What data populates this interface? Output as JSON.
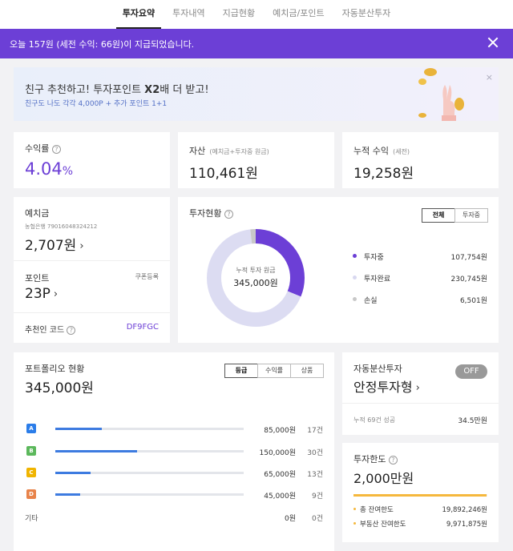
{
  "nav": {
    "tabs": [
      "투자요약",
      "투자내역",
      "지급현황",
      "예치금/포인트",
      "자동분산투자"
    ]
  },
  "notice": {
    "text": "오늘 157원 (세전 수익: 66원)이 지급되었습니다."
  },
  "promo": {
    "title_pre": "친구 추천하고! 투자포인트 ",
    "title_bold": "X2",
    "title_post": "배 더 받고!",
    "subtitle": "친구도 나도 각각 4,000P + 추가 포인트 1+1",
    "close": "×"
  },
  "return_card": {
    "label": "수익률",
    "value": "4.04",
    "unit": "%",
    "color": "#6c3fd6"
  },
  "asset_card": {
    "label": "자산",
    "sub": "(예치금+투자중 원금)",
    "value": "110,461원"
  },
  "cum_card": {
    "label": "누적 수익",
    "sub": "(세전)",
    "value": "19,258원"
  },
  "deposit_card": {
    "label": "예치금",
    "account": "농협은행 79016048324212",
    "value": "2,707원"
  },
  "point_card": {
    "label": "포인트",
    "coupon": "쿠폰등록",
    "value": "23P"
  },
  "referral": {
    "label": "추천인 코드",
    "code": "DF9FGC"
  },
  "invest_status": {
    "label": "투자현황",
    "buttons": [
      "전체",
      "투자중"
    ],
    "center_label": "누적 투자 원금",
    "center_value": "345,000원",
    "legend": [
      {
        "name": "투자중",
        "amount": "107,754원",
        "value": 107754,
        "color": "#6c3fd6"
      },
      {
        "name": "투자완료",
        "amount": "230,745원",
        "value": 230745,
        "color": "#dcdcf2"
      },
      {
        "name": "손실",
        "amount": "6,501원",
        "value": 6501,
        "color": "#c8c8c8"
      }
    ]
  },
  "portfolio": {
    "label": "포트폴리오 현황",
    "value": "345,000원",
    "buttons": [
      "등급",
      "수익률",
      "상품"
    ],
    "rows": [
      {
        "grade": "A",
        "color": "#2b7de9",
        "amount": "85,000원",
        "count": "17건",
        "share": 0.246
      },
      {
        "grade": "B",
        "color": "#5cb85c",
        "amount": "150,000원",
        "count": "30건",
        "share": 0.435
      },
      {
        "grade": "C",
        "color": "#f0b400",
        "amount": "65,000원",
        "count": "13건",
        "share": 0.188
      },
      {
        "grade": "D",
        "color": "#e8834a",
        "amount": "45,000원",
        "count": "9건",
        "share": 0.13
      },
      {
        "grade": "기타",
        "color": "",
        "amount": "0원",
        "count": "0건",
        "share": 0
      }
    ]
  },
  "auto": {
    "label": "자동분산투자",
    "toggle": "OFF",
    "plan": "안정투자형",
    "footer_label": "누적 69건 성공",
    "footer_value": "34.5만원"
  },
  "limit": {
    "label": "투자한도",
    "value": "2,000만원",
    "rows": [
      {
        "name": "총 잔여한도",
        "amount": "19,892,246원"
      },
      {
        "name": "부동산 잔여한도",
        "amount": "9,971,875원"
      }
    ],
    "bar_color": "#f5b83d",
    "fill": 0.995
  }
}
